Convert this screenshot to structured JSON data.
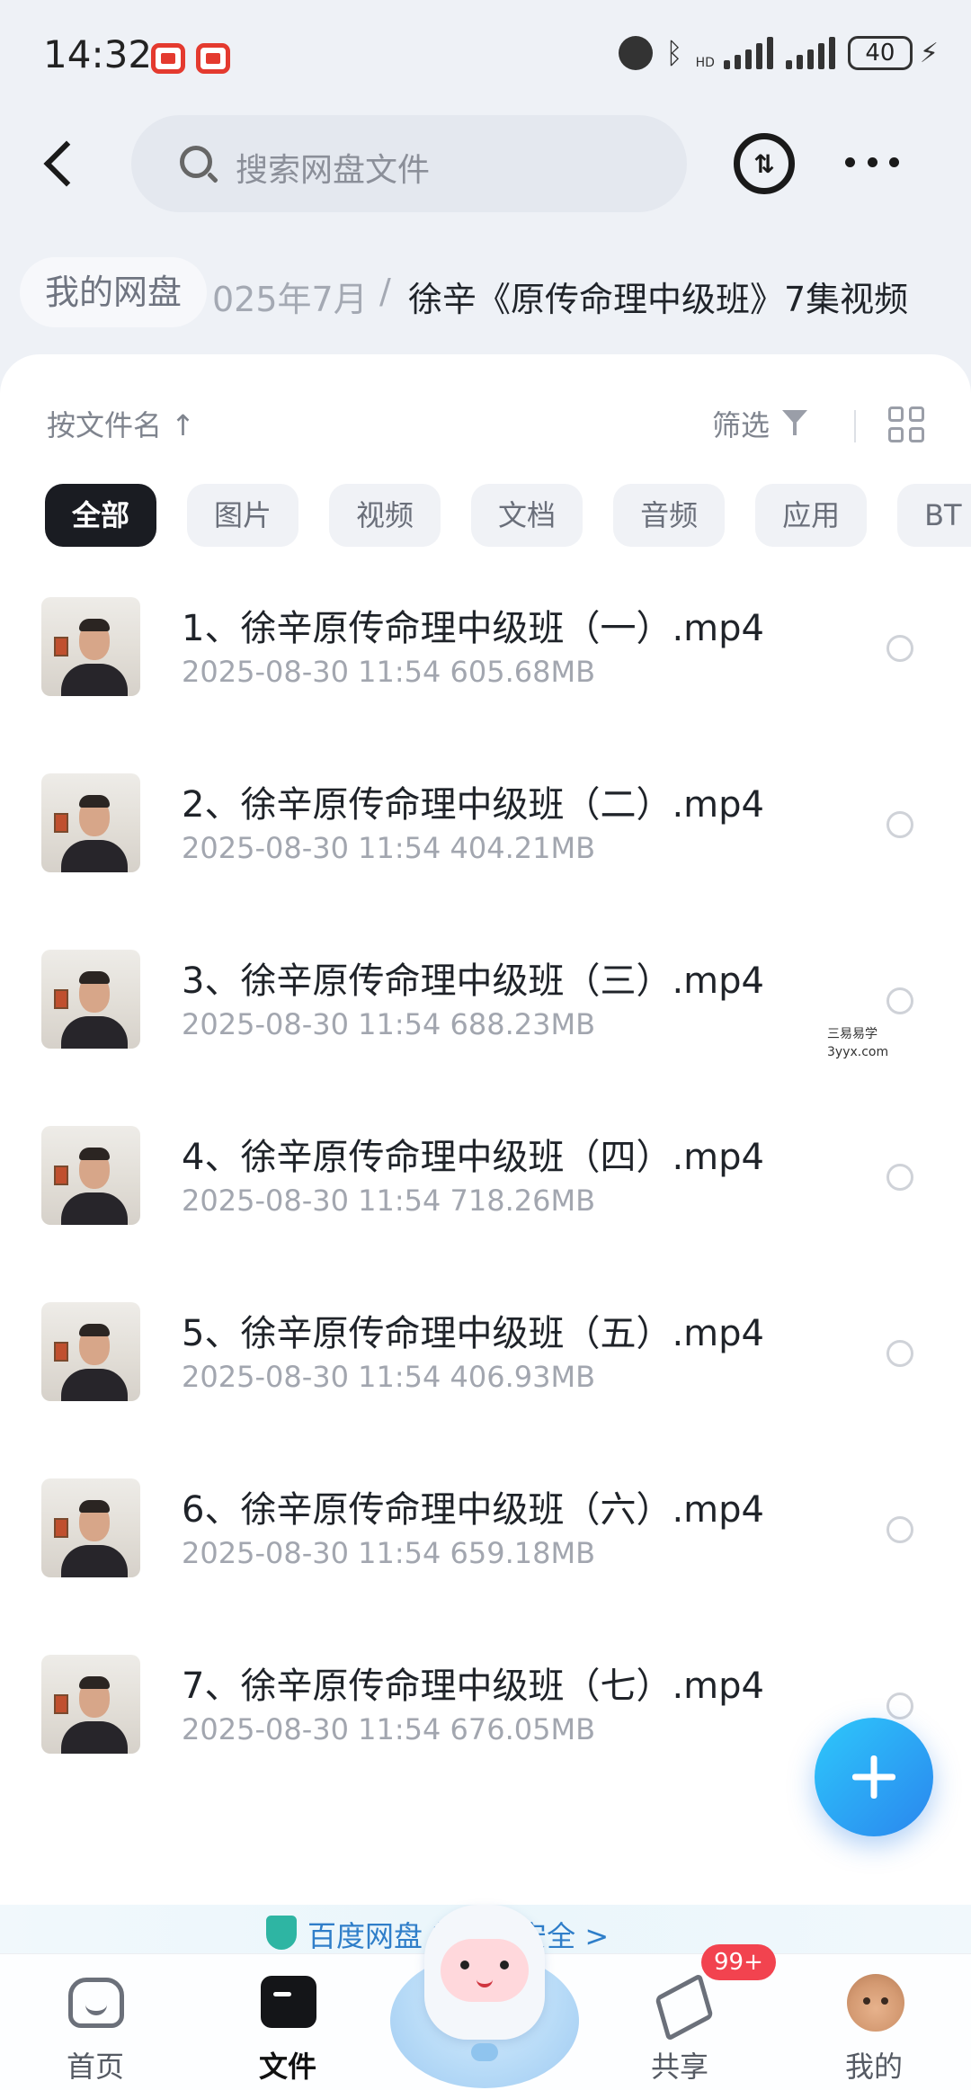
{
  "status_bar": {
    "time": "14:32",
    "network_label": "HD",
    "battery": "40"
  },
  "top_bar": {
    "search_placeholder": "搜索网盘文件",
    "transfer_icon_text": "⇅"
  },
  "breadcrumb": {
    "root": "我的网盘",
    "middle": "025年7月",
    "separator": "/",
    "current": "徐辛《原传命理中级班》7集视频"
  },
  "toolbar": {
    "sort_label": "按文件名 ↑",
    "filter_label": "筛选"
  },
  "filter_chips": [
    {
      "label": "全部",
      "active": true
    },
    {
      "label": "图片",
      "active": false
    },
    {
      "label": "视频",
      "active": false
    },
    {
      "label": "文档",
      "active": false
    },
    {
      "label": "音频",
      "active": false
    },
    {
      "label": "应用",
      "active": false
    },
    {
      "label": "BT",
      "active": false
    }
  ],
  "files": [
    {
      "name": "1、徐辛原传命理中级班（一）.mp4",
      "date": "2025-08-30",
      "time": "11:54",
      "size": "605.68MB"
    },
    {
      "name": "2、徐辛原传命理中级班（二）.mp4",
      "date": "2025-08-30",
      "time": "11:54",
      "size": "404.21MB"
    },
    {
      "name": "3、徐辛原传命理中级班（三）.mp4",
      "date": "2025-08-30",
      "time": "11:54",
      "size": "688.23MB"
    },
    {
      "name": "4、徐辛原传命理中级班（四）.mp4",
      "date": "2025-08-30",
      "time": "11:54",
      "size": "718.26MB"
    },
    {
      "name": "5、徐辛原传命理中级班（五）.mp4",
      "date": "2025-08-30",
      "time": "11:54",
      "size": "406.93MB"
    },
    {
      "name": "6、徐辛原传命理中级班（六）.mp4",
      "date": "2025-08-30",
      "time": "11:54",
      "size": "659.18MB"
    },
    {
      "name": "7、徐辛原传命理中级班（七）.mp4",
      "date": "2025-08-30",
      "time": "11:54",
      "size": "676.05MB"
    }
  ],
  "watermark": {
    "line1": "三易易学",
    "line2": "3yyx.com"
  },
  "banner": {
    "text": "百度网盘 的数据安全 >"
  },
  "tab_bar": {
    "tabs": [
      {
        "label": "首页",
        "icon": "home-icon"
      },
      {
        "label": "文件",
        "icon": "folder-icon",
        "active": true
      },
      {
        "label": "共享",
        "icon": "share-icon",
        "badge": "99+"
      },
      {
        "label": "我的",
        "icon": "avatar"
      }
    ]
  },
  "colors": {
    "accent": "#2a86ee",
    "active_chip": "#1a1c22",
    "badge": "#f2434f"
  }
}
